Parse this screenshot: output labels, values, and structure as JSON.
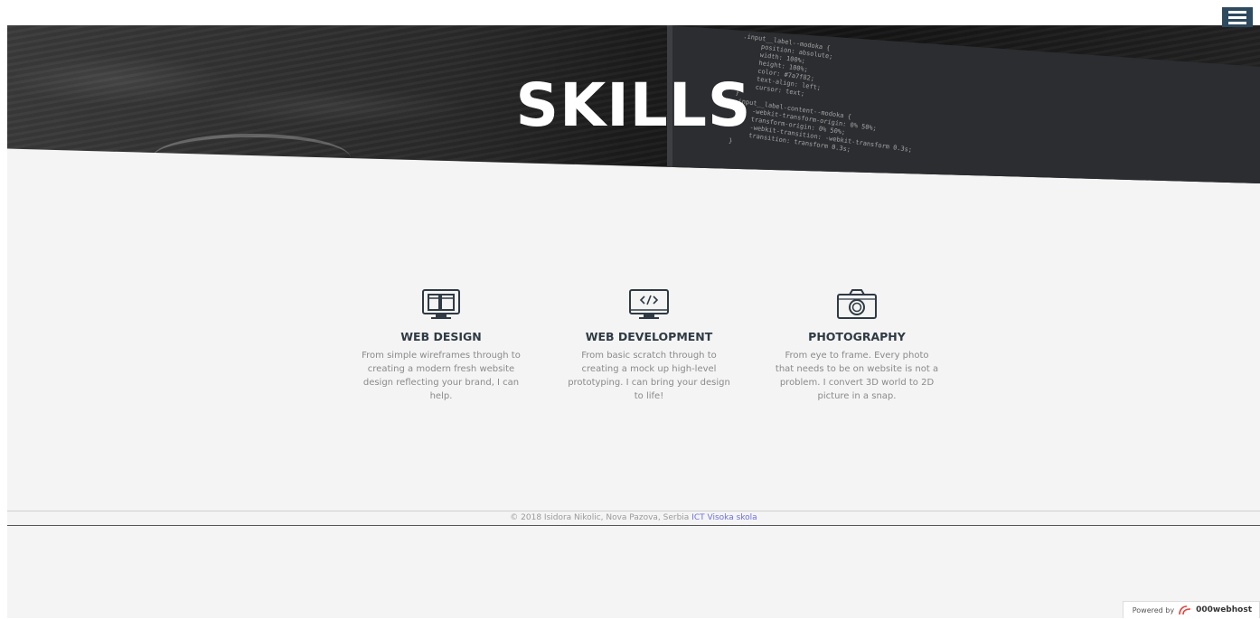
{
  "header": {
    "menu_icon": "hamburger-menu-icon",
    "title": "SKILLS"
  },
  "skills": [
    {
      "icon": "tablet-mobile-icon",
      "title": "WEB DESIGN",
      "description": "From simple wireframes through to creating a modern fresh website design reflecting your brand, I can help."
    },
    {
      "icon": "monitor-code-icon",
      "title": "WEB DEVELOPMENT",
      "description": "From basic scratch through to creating a mock up high-level prototyping. I can bring your design to life!"
    },
    {
      "icon": "camera-icon",
      "title": "PHOTOGRAPHY",
      "description": "From eye to frame. Every photo that needs to be on website is not a problem. I convert 3D world to 2D picture in a snap."
    }
  ],
  "footer": {
    "copyright": "© 2018 Isidora Nikolic, Nova Pazova, Serbia",
    "link_text": "ICT Visoka skola"
  },
  "badge": {
    "prefix": "Powered by",
    "brand": "000webhost",
    "logo_icon": "000webhost-logo-icon"
  },
  "colors": {
    "accent": "#2d4a5e",
    "link": "#6f6fe0",
    "heading": "#2f3a44",
    "body_text": "#8a8a8a",
    "background": "#f4f4f4"
  }
}
